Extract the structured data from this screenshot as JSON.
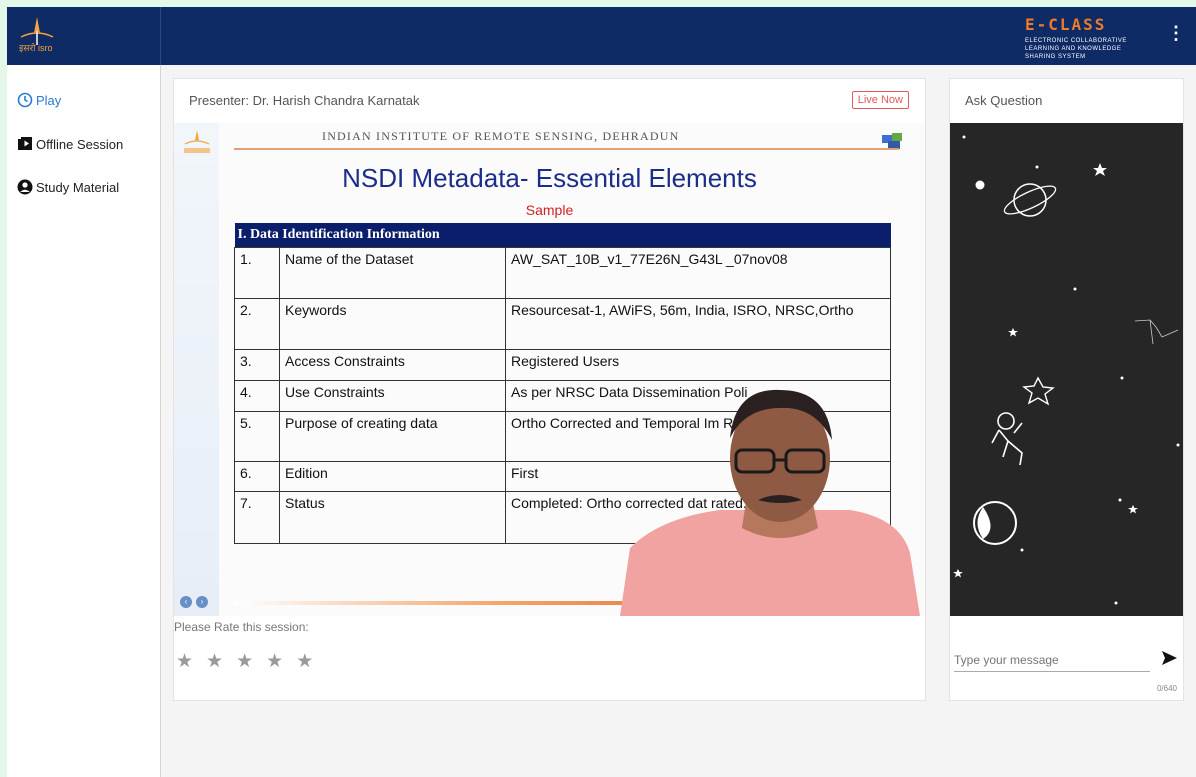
{
  "header": {
    "logo_text": "इसरो isro",
    "brand_name": "E-CLASS",
    "brand_tagline": "ELECTRONIC COLLABORATIVE LEARNING AND KNOWLEDGE SHARING SYSTEM",
    "menu_icon": "kebab-menu-icon",
    "colors": {
      "header_bg": "#0f2b66",
      "brand_accent": "#ef7a2a"
    }
  },
  "sidebar": {
    "items": [
      {
        "label": "Play",
        "icon": "clock-icon",
        "active": true
      },
      {
        "label": "Offline Session",
        "icon": "play-box-icon",
        "active": false
      },
      {
        "label": "Study Material",
        "icon": "user-circle-icon",
        "active": false
      }
    ],
    "active_color": "#2a7ad5"
  },
  "video_panel": {
    "presenter": "Presenter: Dr. Harish Chandra Karnatak",
    "live_label": "Live Now",
    "slide": {
      "header": "INDIAN INSTITUTE OF REMOTE SENSING, DEHRADUN",
      "title": "NSDI Metadata- Essential Elements",
      "subtitle": "Sample",
      "section": "I. Data Identification Information",
      "rows": [
        {
          "num": "1.",
          "name": "Name of the Dataset",
          "value": "AW_SAT_10B_v1_77E26N_G43L _07nov08"
        },
        {
          "num": "2.",
          "name": "Keywords",
          "value": "Resourcesat-1, AWiFS, 56m, India, ISRO, NRSC,Ortho"
        },
        {
          "num": "3.",
          "name": "Access Constraints",
          "value": "Registered Users"
        },
        {
          "num": "4.",
          "name": "Use Constraints",
          "value": "As per NRSC Data Dissemination Poli"
        },
        {
          "num": "5.",
          "name": "Purpose of creating data",
          "value": "Ortho Corrected and Temporal Im Resourcesat-1"
        },
        {
          "num": "6.",
          "name": "Edition",
          "value": "First"
        },
        {
          "num": "7.",
          "name": "Status",
          "value": "Completed: Ortho corrected dat rated."
        }
      ]
    },
    "rating_label": "Please Rate this session:",
    "rating": {
      "max": 5,
      "value": 0
    }
  },
  "chat": {
    "title": "Ask Question",
    "placeholder": "Type your message",
    "counter": "0/640",
    "send_icon": "send-icon"
  }
}
